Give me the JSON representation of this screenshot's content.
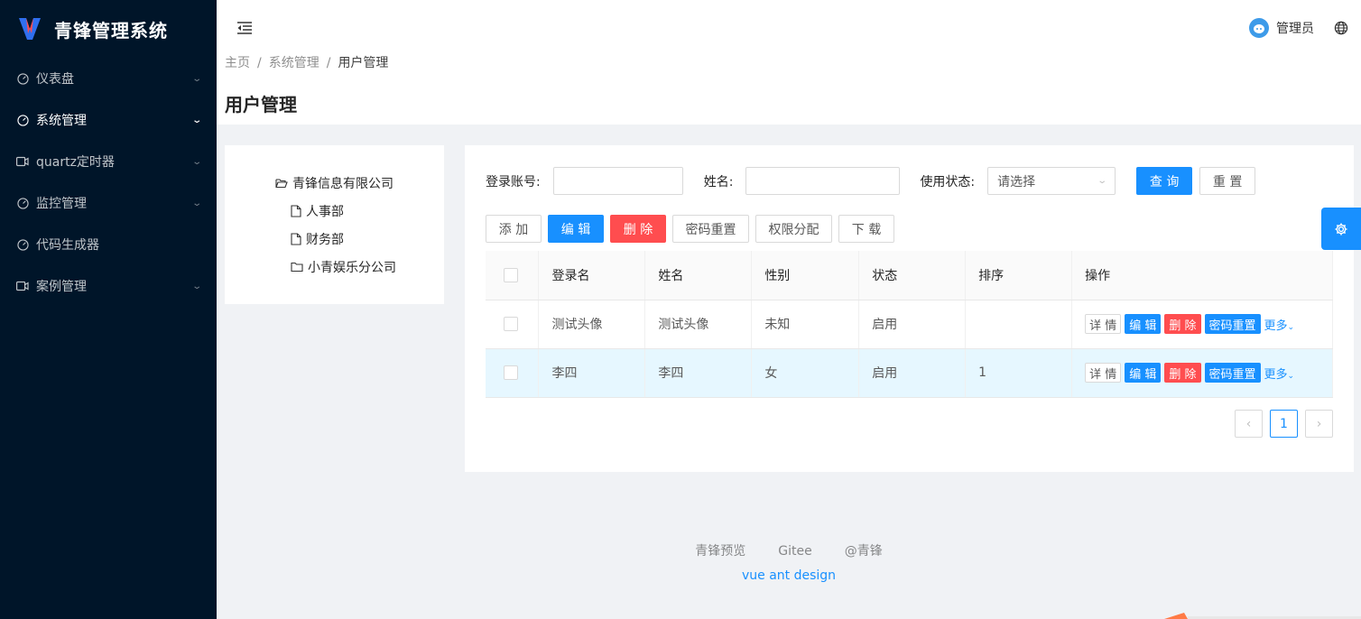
{
  "app": {
    "title": "青锋管理系统"
  },
  "sidebar": {
    "items": [
      {
        "label": "仪表盘",
        "icon": "dashboard-icon"
      },
      {
        "label": "系统管理",
        "icon": "dashboard-icon"
      },
      {
        "label": "quartz定时器",
        "icon": "video-icon"
      },
      {
        "label": "监控管理",
        "icon": "dashboard-icon"
      },
      {
        "label": "代码生成器",
        "icon": "dashboard-icon"
      },
      {
        "label": "案例管理",
        "icon": "video-icon"
      }
    ]
  },
  "header": {
    "user": "管理员"
  },
  "breadcrumb": {
    "home": "主页",
    "sep": "/",
    "parent": "系统管理",
    "current": "用户管理"
  },
  "page": {
    "title": "用户管理"
  },
  "tree": {
    "root": "青锋信息有限公司",
    "children": [
      "人事部",
      "财务部",
      "小青娱乐分公司"
    ]
  },
  "search": {
    "account_label": "登录账号:",
    "name_label": "姓名:",
    "status_label": "使用状态:",
    "status_placeholder": "请选择",
    "query": "查 询",
    "reset": "重 置"
  },
  "toolbar": {
    "add": "添 加",
    "edit": "编 辑",
    "delete": "删 除",
    "reset_pwd": "密码重置",
    "assign": "权限分配",
    "download": "下 载"
  },
  "table": {
    "columns": [
      "登录名",
      "姓名",
      "性别",
      "状态",
      "排序",
      "操作"
    ],
    "rows": [
      {
        "login": "测试头像",
        "name": "测试头像",
        "gender": "未知",
        "status": "启用",
        "sort": ""
      },
      {
        "login": "李四",
        "name": "李四",
        "gender": "女",
        "status": "启用",
        "sort": "1"
      }
    ],
    "ops": {
      "detail": "详 情",
      "edit": "编 辑",
      "delete": "删 除",
      "reset": "密码重置",
      "more": "更多"
    }
  },
  "pagination": {
    "current": "1"
  },
  "footer": {
    "links": [
      "青锋预览",
      "Gitee",
      "@青锋"
    ],
    "sub": "vue ant design"
  },
  "colors": {
    "primary": "#1890ff",
    "danger": "#ff4d4f",
    "sider": "#001529"
  }
}
